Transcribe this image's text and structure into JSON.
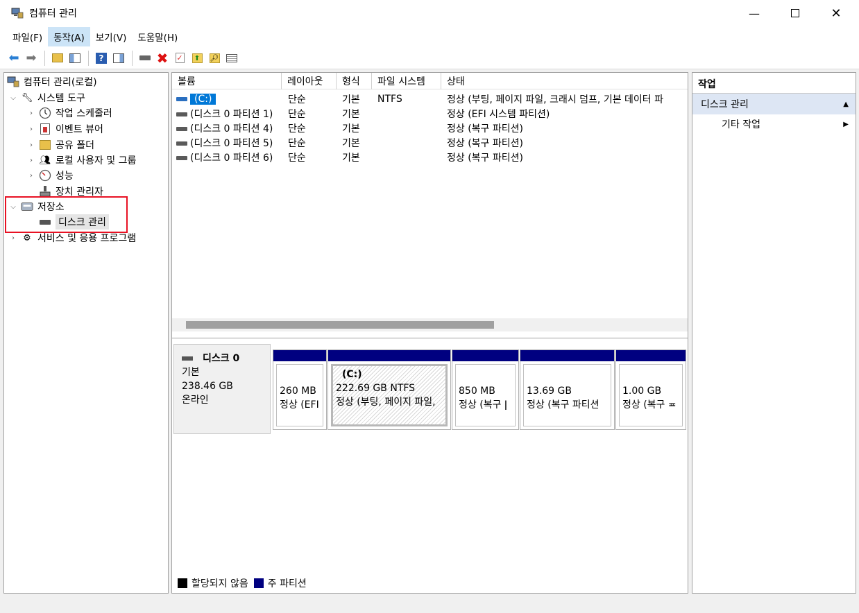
{
  "window": {
    "title": "컴퓨터 관리"
  },
  "menu": [
    {
      "label": "파일(F)",
      "active": false
    },
    {
      "label": "동작(A)",
      "active": true
    },
    {
      "label": "보기(V)",
      "active": false
    },
    {
      "label": "도움말(H)",
      "active": false
    }
  ],
  "tree": {
    "root": "컴퓨터 관리(로컬)",
    "system_tools": "시스템 도구",
    "task_scheduler": "작업 스케줄러",
    "event_viewer": "이벤트 뷰어",
    "shared_folders": "공유 폴더",
    "local_users": "로컬 사용자 및 그룹",
    "performance": "성능",
    "device_manager": "장치 관리자",
    "storage": "저장소",
    "disk_management": "디스크 관리",
    "services": "서비스 및 응용 프로그램"
  },
  "volume_table": {
    "headers": [
      "볼륨",
      "레이아웃",
      "형식",
      "파일 시스템",
      "상태"
    ],
    "rows": [
      {
        "volume": "(C:)",
        "layout": "단순",
        "type": "기본",
        "fs": "NTFS",
        "status": "정상 (부팅, 페이지 파일, 크래시 덤프, 기본 데이터 파"
      },
      {
        "volume": "(디스크 0 파티션 1)",
        "layout": "단순",
        "type": "기본",
        "fs": "",
        "status": "정상 (EFI 시스템 파티션)"
      },
      {
        "volume": "(디스크 0 파티션 4)",
        "layout": "단순",
        "type": "기본",
        "fs": "",
        "status": "정상 (복구 파티션)"
      },
      {
        "volume": "(디스크 0 파티션 5)",
        "layout": "단순",
        "type": "기본",
        "fs": "",
        "status": "정상 (복구 파티션)"
      },
      {
        "volume": "(디스크 0 파티션 6)",
        "layout": "단순",
        "type": "기본",
        "fs": "",
        "status": "정상 (복구 파티션)"
      }
    ]
  },
  "disk": {
    "name": "디스크 0",
    "kind": "기본",
    "size": "238.46 GB",
    "state": "온라인",
    "partitions": [
      {
        "label": "",
        "size": "260 MB",
        "status": "정상 (EFI"
      },
      {
        "label": "(C:)",
        "size": "222.69 GB NTFS",
        "status": "정상 (부팅, 페이지 파일,"
      },
      {
        "label": "",
        "size": "850 MB",
        "status": "정상 (복구 ǀ"
      },
      {
        "label": "",
        "size": "13.69 GB",
        "status": "정상 (복구 파티션"
      },
      {
        "label": "",
        "size": "1.00 GB",
        "status": "정상 (복구 ≖"
      }
    ]
  },
  "legend": {
    "unallocated": "할당되지 않음",
    "primary": "주 파티션",
    "unallocated_color": "#000000",
    "primary_color": "#000080"
  },
  "actions": {
    "header": "작업",
    "section": "디스크 관리",
    "more": "기타 작업"
  }
}
